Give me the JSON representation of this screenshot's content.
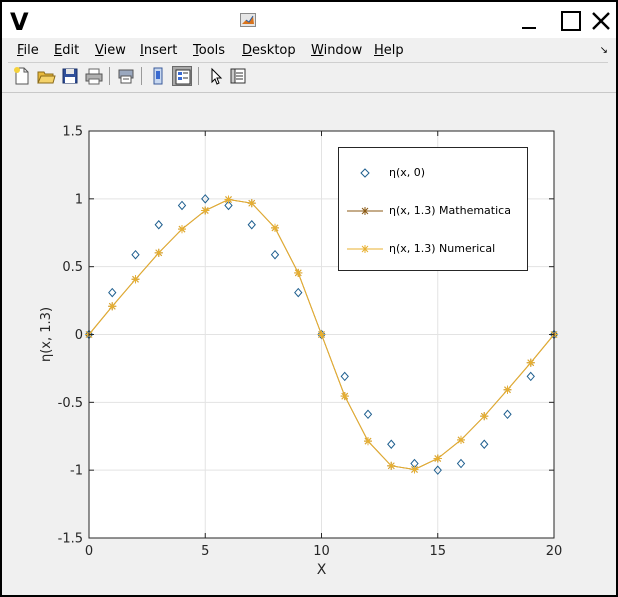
{
  "window": {
    "app_glyph": "V"
  },
  "menu": {
    "items": [
      "File",
      "Edit",
      "View",
      "Insert",
      "Tools",
      "Desktop",
      "Window",
      "Help"
    ]
  },
  "toolbar": {
    "icons": [
      "new-figure-icon",
      "open-file-icon",
      "save-icon",
      "print-icon",
      "print-preview-icon",
      "hide-plot-tools-icon",
      "show-plot-tools-icon",
      "edit-plot-arrow-icon",
      "property-inspector-icon"
    ]
  },
  "chart_data": {
    "type": "line",
    "xlabel": "X",
    "ylabel": "η(x, 1.3)",
    "xlim": [
      0,
      20
    ],
    "ylim": [
      -1.5,
      1.5
    ],
    "xticks": [
      0,
      5,
      10,
      15,
      20
    ],
    "yticks": [
      -1.5,
      -1,
      -0.5,
      0,
      0.5,
      1,
      1.5
    ],
    "ytick_labels": [
      "-1.5",
      "-1",
      "-0.5",
      "0",
      "0.5",
      "1",
      "1.5"
    ],
    "grid": true,
    "legend_position": "top-right",
    "x": [
      0,
      1,
      2,
      3,
      4,
      5,
      6,
      7,
      8,
      9,
      10,
      11,
      12,
      13,
      14,
      15,
      16,
      17,
      18,
      19,
      20
    ],
    "series": [
      {
        "name": "η(x, 0)",
        "marker": "diamond",
        "line": false,
        "color": "#1f5f8f",
        "values": [
          0,
          0.309,
          0.588,
          0.809,
          0.951,
          1.0,
          0.951,
          0.809,
          0.588,
          0.309,
          0,
          -0.309,
          -0.588,
          -0.809,
          -0.951,
          -1.0,
          -0.951,
          -0.809,
          -0.588,
          -0.309,
          0
        ]
      },
      {
        "name": "η(x, 1.3) Mathematica",
        "marker": "asterisk",
        "line": true,
        "color": "#8b5a14",
        "values": [
          0,
          0.208,
          0.407,
          0.602,
          0.777,
          0.914,
          0.995,
          0.968,
          0.786,
          0.454,
          0,
          -0.454,
          -0.786,
          -0.968,
          -0.995,
          -0.914,
          -0.777,
          -0.602,
          -0.407,
          -0.208,
          0
        ]
      },
      {
        "name": "η(x, 1.3) Numerical",
        "marker": "asterisk",
        "line": true,
        "color": "#e8b030",
        "values": [
          0,
          0.208,
          0.407,
          0.602,
          0.777,
          0.914,
          0.995,
          0.968,
          0.786,
          0.454,
          0,
          -0.454,
          -0.786,
          -0.968,
          -0.995,
          -0.914,
          -0.777,
          -0.602,
          -0.407,
          -0.208,
          0
        ]
      }
    ]
  }
}
